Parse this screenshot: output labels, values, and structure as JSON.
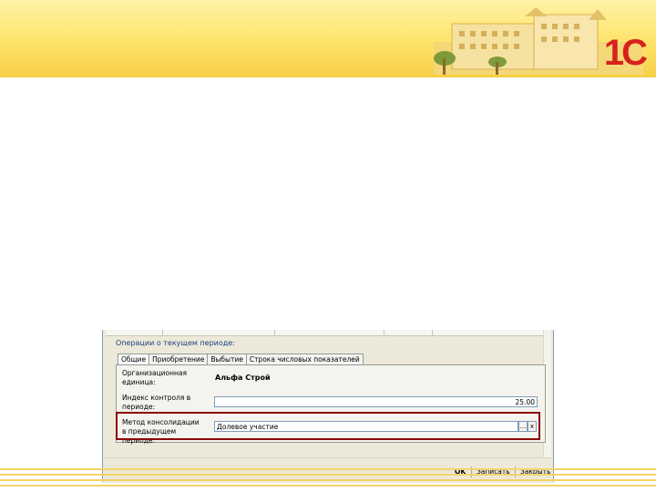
{
  "brand": {
    "logo_text": "1С",
    "accent": "#d8211c",
    "banner_color": "#ffe36a"
  },
  "window": {
    "group_title": "Операции о текущем периоде:",
    "tabs": [
      "Общие",
      "Приобретение",
      "Выбытие",
      "Строка числовых показателей"
    ],
    "active_tab": "Общие",
    "fields": {
      "org_unit_label": "Организационная единица:",
      "org_unit_value": "Альфа Строй",
      "control_index_label": "Индекс контроля в периоде:",
      "control_index_value": "25.00",
      "method_label": "Метод консолидации в предыдущем периоде:",
      "method_value": "Долевое участие",
      "select_button": "...",
      "clear_button": "x"
    },
    "buttons": {
      "ok": "OK",
      "save": "Записать",
      "close": "Закрыть"
    }
  }
}
